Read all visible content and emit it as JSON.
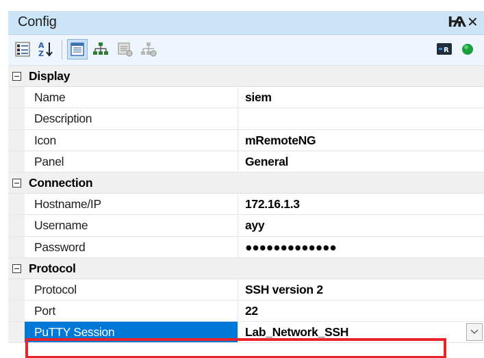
{
  "panel": {
    "title": "Config",
    "pin_glyph": "Ѩ",
    "close_glyph": "✕"
  },
  "toolbar": {
    "buttons": [
      {
        "icon": "categorized-view-icon",
        "active": false
      },
      {
        "icon": "alphabetical-sort-icon",
        "active": false
      },
      {
        "icon": "properties-icon",
        "active": true
      },
      {
        "icon": "inheritance-icon",
        "active": false
      },
      {
        "icon": "default-properties-icon",
        "active": false
      },
      {
        "icon": "default-inheritance-icon",
        "active": false
      },
      {
        "icon": "host-status-icon",
        "active": false
      },
      {
        "icon": "status-online-icon",
        "active": false
      }
    ],
    "accent": "#1a9f3a"
  },
  "grid": {
    "categories": [
      {
        "label": "Display",
        "properties": [
          {
            "name": "Name",
            "value": "siem"
          },
          {
            "name": "Description",
            "value": ""
          },
          {
            "name": "Icon",
            "value": "mRemoteNG"
          },
          {
            "name": "Panel",
            "value": "General"
          }
        ]
      },
      {
        "label": "Connection",
        "properties": [
          {
            "name": "Hostname/IP",
            "value": "172.16.1.3"
          },
          {
            "name": "Username",
            "value": "ayy"
          },
          {
            "name": "Password",
            "value": "●●●●●●●●●●●●●"
          }
        ]
      },
      {
        "label": "Protocol",
        "properties": [
          {
            "name": "Protocol",
            "value": "SSH version 2"
          },
          {
            "name": "Port",
            "value": "22"
          },
          {
            "name": "PuTTY Session",
            "value": "Lab_Network_SSH",
            "selected": true
          }
        ]
      }
    ]
  },
  "colors": {
    "selection": "#0078d7",
    "highlight_outline": "#e8232a",
    "titlebar": "#cce4f7"
  }
}
